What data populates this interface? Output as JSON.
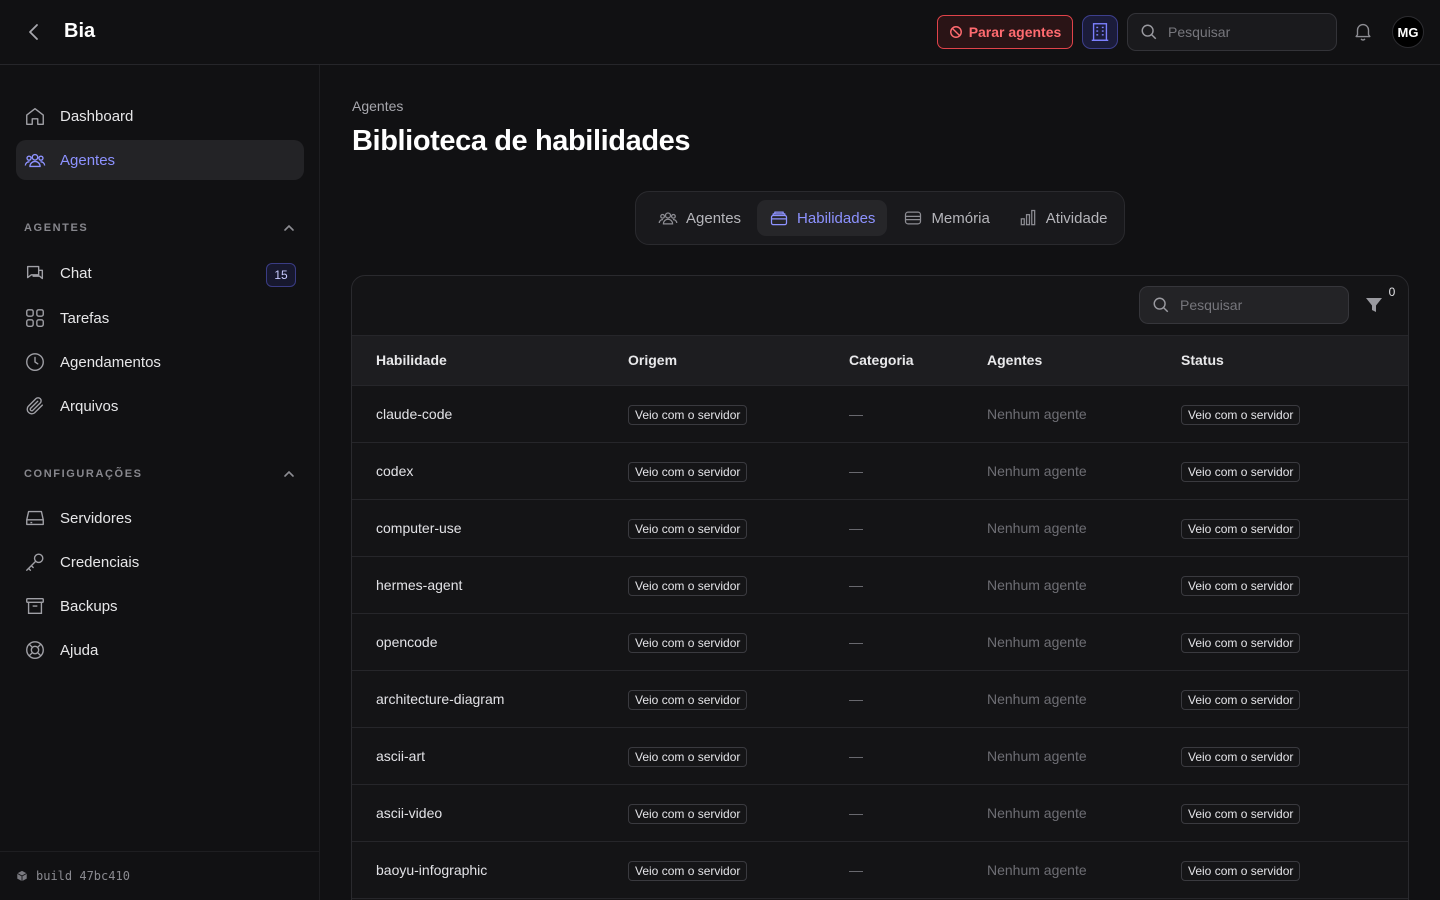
{
  "header": {
    "title": "Bia",
    "stop_agents_label": "Parar agentes",
    "search_placeholder": "Pesquisar",
    "avatar_initials": "MG"
  },
  "sidebar": {
    "top_items": [
      {
        "label": "Dashboard",
        "icon": "home-icon"
      },
      {
        "label": "Agentes",
        "icon": "users-icon",
        "active": true
      }
    ],
    "sections": [
      {
        "title": "AGENTES",
        "items": [
          {
            "label": "Chat",
            "icon": "chat-icon",
            "badge": "15"
          },
          {
            "label": "Tarefas",
            "icon": "grid-icon"
          },
          {
            "label": "Agendamentos",
            "icon": "clock-icon"
          },
          {
            "label": "Arquivos",
            "icon": "paperclip-icon"
          }
        ]
      },
      {
        "title": "CONFIGURAÇÕES",
        "items": [
          {
            "label": "Servidores",
            "icon": "server-icon"
          },
          {
            "label": "Credenciais",
            "icon": "key-icon"
          },
          {
            "label": "Backups",
            "icon": "archive-icon"
          },
          {
            "label": "Ajuda",
            "icon": "lifebuoy-icon"
          }
        ]
      }
    ],
    "build_label": "build 47bc410"
  },
  "main": {
    "breadcrumb": "Agentes",
    "title": "Biblioteca de habilidades",
    "tabs": [
      {
        "label": "Agentes",
        "icon": "users-icon"
      },
      {
        "label": "Habilidades",
        "icon": "stack-icon",
        "active": true
      },
      {
        "label": "Memória",
        "icon": "database-icon"
      },
      {
        "label": "Atividade",
        "icon": "bar-chart-icon"
      }
    ],
    "table": {
      "search_placeholder": "Pesquisar",
      "filter_count": "0",
      "columns": [
        "Habilidade",
        "Origem",
        "Categoria",
        "Agentes",
        "Status"
      ],
      "rows": [
        {
          "name": "claude-code",
          "origin": "Veio com o servidor",
          "category": "—",
          "agents": "Nenhum agente",
          "status": "Veio com o servidor"
        },
        {
          "name": "codex",
          "origin": "Veio com o servidor",
          "category": "—",
          "agents": "Nenhum agente",
          "status": "Veio com o servidor"
        },
        {
          "name": "computer-use",
          "origin": "Veio com o servidor",
          "category": "—",
          "agents": "Nenhum agente",
          "status": "Veio com o servidor"
        },
        {
          "name": "hermes-agent",
          "origin": "Veio com o servidor",
          "category": "—",
          "agents": "Nenhum agente",
          "status": "Veio com o servidor"
        },
        {
          "name": "opencode",
          "origin": "Veio com o servidor",
          "category": "—",
          "agents": "Nenhum agente",
          "status": "Veio com o servidor"
        },
        {
          "name": "architecture-diagram",
          "origin": "Veio com o servidor",
          "category": "—",
          "agents": "Nenhum agente",
          "status": "Veio com o servidor"
        },
        {
          "name": "ascii-art",
          "origin": "Veio com o servidor",
          "category": "—",
          "agents": "Nenhum agente",
          "status": "Veio com o servidor"
        },
        {
          "name": "ascii-video",
          "origin": "Veio com o servidor",
          "category": "—",
          "agents": "Nenhum agente",
          "status": "Veio com o servidor"
        },
        {
          "name": "baoyu-infographic",
          "origin": "Veio com o servidor",
          "category": "—",
          "agents": "Nenhum agente",
          "status": "Veio com o servidor"
        }
      ]
    }
  },
  "colors": {
    "accent": "#8d92ff",
    "danger": "#e0434a",
    "background": "#111113"
  }
}
